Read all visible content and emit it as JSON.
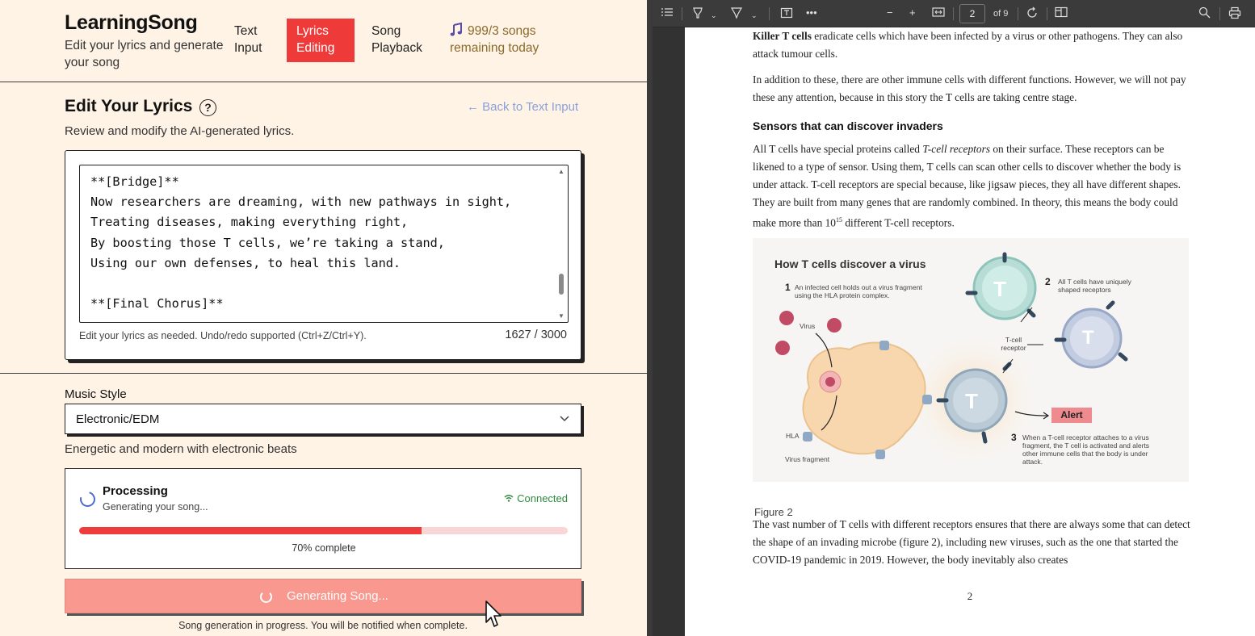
{
  "app": {
    "brand": {
      "title": "LearningSong",
      "subtitle": "Edit your lyrics and generate your song"
    },
    "nav": {
      "text_input": "Text Input",
      "lyrics_editing": "Lyrics Editing",
      "song_playback": "Song Playback",
      "quota": "999/3 songs remaining today"
    },
    "editor": {
      "title": "Edit Your Lyrics",
      "help_symbol": "?",
      "back_link": "← Back to Text Input",
      "subtitle": "Review and modify the AI-generated lyrics.",
      "lyrics": "**[Bridge]**\nNow researchers are dreaming, with new pathways in sight,\nTreating diseases, making everything right,\nBy boosting those T cells, we’re taking a stand,\nUsing our own defenses, to heal this land.\n\n**[Final Chorus]**",
      "hint": "Edit your lyrics as needed. Undo/redo supported (Ctrl+Z/Ctrl+Y).",
      "count": "1627 / 3000"
    },
    "music": {
      "label": "Music Style",
      "selected": "Electronic/EDM",
      "description": "Energetic and modern with electronic beats"
    },
    "processing": {
      "title": "Processing",
      "subtitle": "Generating your song...",
      "connection": "Connected",
      "progress": 0.7,
      "progress_label": "70% complete"
    },
    "generate": {
      "label": "Generating Song...",
      "note": "Song generation in progress. You will be notified when complete."
    }
  },
  "pdf": {
    "toolbar": {
      "page": "2",
      "of": "of 9"
    },
    "para1_bold": "Killer T cells",
    "para1": " eradicate cells which have been infected by a virus or other pathogens. They can also attack tumour cells.",
    "para2": "In addition to these, there are other immune cells with different functions. However, we will not pay these any attention, because in this story the T cells are taking centre stage.",
    "heading": "Sensors that can discover invaders",
    "para3_a": "All T cells have special proteins called ",
    "para3_em": "T-cell receptors",
    "para3_b": " on their surface. These receptors can be likened to a type of sensor. Using them, T cells can scan other cells to discover whether the body is under attack. T-cell receptors are special because, like jigsaw pieces, they all have different shapes. They are built from many genes that are randomly combined. In theory, this means the body could make more than 10",
    "para3_sup": "15",
    "para3_c": " different T-cell receptors.",
    "figure": {
      "title": "How T cells discover a virus",
      "n1": "1",
      "step1": "An infected cell holds out a virus fragment using the HLA protein complex.",
      "n2": "2",
      "step2": "All T cells have uniquely shaped receptors",
      "n3": "3",
      "step3": "When a T-cell receptor attaches to a virus fragment, the T cell is activated and alerts other immune cells that the body is under attack.",
      "virus": "Virus",
      "receptor": "T-cell receptor",
      "hla": "HLA",
      "fragment": "Virus fragment",
      "alert": "Alert",
      "t": "T"
    },
    "caption": "Figure 2",
    "para4": "The vast number of T cells with different receptors ensures that there are always some that can detect the shape of an invading microbe (figure 2), including new viruses, such as the one that started the COVID-19 pandemic in 2019. However, the body inevitably also creates",
    "page_number": "2"
  }
}
